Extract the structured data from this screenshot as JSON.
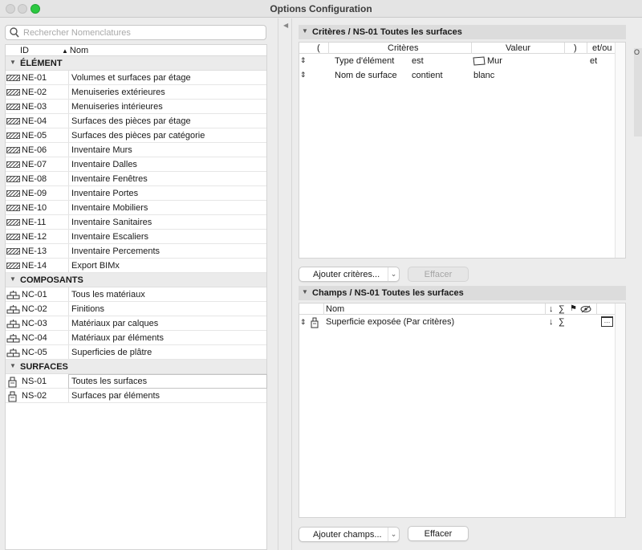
{
  "window": {
    "title": "Options Configuration"
  },
  "search": {
    "placeholder": "Rechercher Nomenclatures"
  },
  "list": {
    "headers": {
      "id": "ID",
      "nom": "Nom"
    },
    "groups": [
      {
        "label": "ÉLÉMENT",
        "icon": "hatch-element-icon",
        "items": [
          {
            "id": "NE-01",
            "name": "Volumes et surfaces par étage"
          },
          {
            "id": "NE-02",
            "name": "Menuiseries extérieures"
          },
          {
            "id": "NE-03",
            "name": "Menuiseries intérieures"
          },
          {
            "id": "NE-04",
            "name": "Surfaces des pièces par étage"
          },
          {
            "id": "NE-05",
            "name": "Surfaces des pièces par catégorie"
          },
          {
            "id": "NE-06",
            "name": "Inventaire Murs"
          },
          {
            "id": "NE-07",
            "name": "Inventaire Dalles"
          },
          {
            "id": "NE-08",
            "name": "Inventaire Fenêtres"
          },
          {
            "id": "NE-09",
            "name": "Inventaire Portes"
          },
          {
            "id": "NE-10",
            "name": "Inventaire Mobiliers"
          },
          {
            "id": "NE-11",
            "name": "Inventaire Sanitaires"
          },
          {
            "id": "NE-12",
            "name": "Inventaire Escaliers"
          },
          {
            "id": "NE-13",
            "name": "Inventaire Percements"
          },
          {
            "id": "NE-14",
            "name": "Export BIMx"
          }
        ]
      },
      {
        "label": "COMPOSANTS",
        "icon": "bricks-icon",
        "items": [
          {
            "id": "NC-01",
            "name": "Tous les matériaux"
          },
          {
            "id": "NC-02",
            "name": "Finitions"
          },
          {
            "id": "NC-03",
            "name": "Matériaux par calques"
          },
          {
            "id": "NC-04",
            "name": "Matériaux par éléments"
          },
          {
            "id": "NC-05",
            "name": "Superficies de plâtre"
          }
        ]
      },
      {
        "label": "SURFACES",
        "icon": "paint-bucket-icon",
        "items": [
          {
            "id": "NS-01",
            "name": "Toutes les surfaces"
          },
          {
            "id": "NS-02",
            "name": "Surfaces par éléments"
          }
        ]
      }
    ]
  },
  "criteres": {
    "title": "Critères / NS-01 Toutes les surfaces",
    "columns": {
      "paren_open": "(",
      "criteres": "Critères",
      "valeur": "Valeur",
      "paren_close": ")",
      "etou": "et/ou"
    },
    "rows": [
      {
        "field": "Type d'élément",
        "op": "est",
        "value": "Mur",
        "etou": "et"
      },
      {
        "field": "Nom de surface",
        "op": "contient",
        "value": "blanc",
        "etou": ""
      }
    ],
    "add_label": "Ajouter critères...",
    "clear_label": "Effacer"
  },
  "champs": {
    "title": "Champs / NS-01 Toutes les surfaces",
    "columns": {
      "nom": "Nom"
    },
    "rows": [
      {
        "name": "Superficie exposée (Par critères)"
      }
    ],
    "add_label": "Ajouter champs...",
    "clear_label": "Effacer"
  },
  "edge": {
    "text": "O"
  },
  "colors": {
    "selected_border": "#c4c4c4",
    "group_bg": "#ebebeb",
    "close_light": "#2bc840"
  }
}
